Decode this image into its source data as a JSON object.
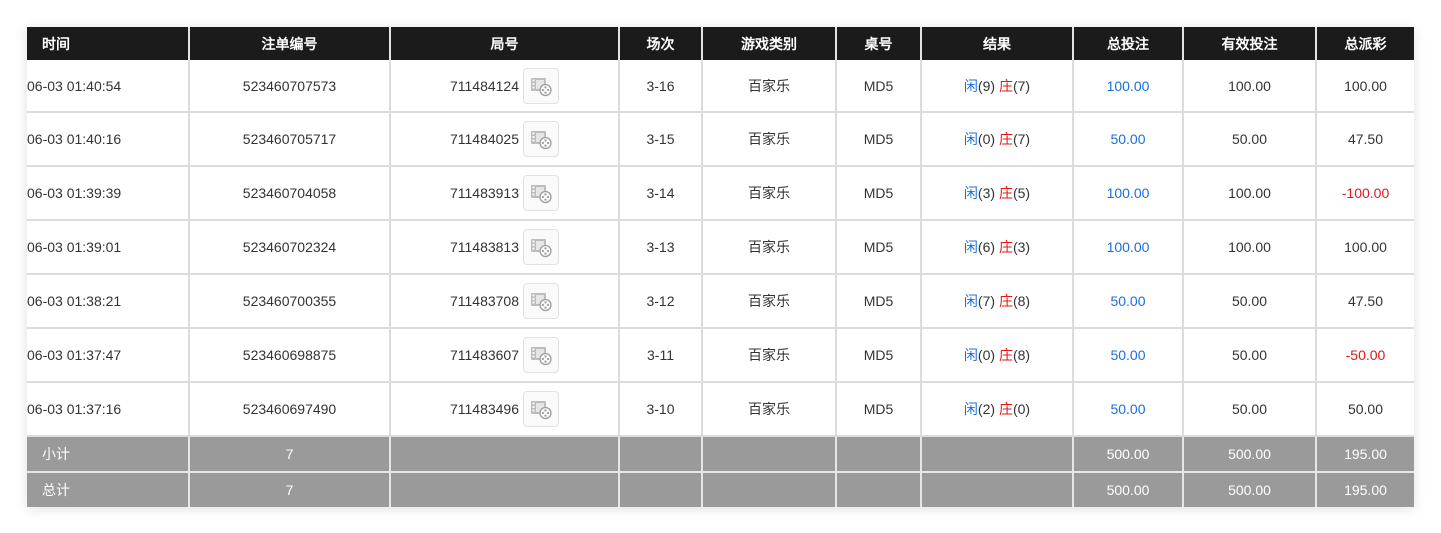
{
  "headers": [
    "时间",
    "注单编号",
    "局号",
    "场次",
    "游戏类别",
    "桌号",
    "结果",
    "总投注",
    "有效投注",
    "总派彩"
  ],
  "rows": [
    {
      "time": "06-03 01:40:54",
      "bet_no": "523460707573",
      "round": "711484124",
      "shoe": "3-16",
      "game": "百家乐",
      "table": "MD5",
      "player_label": "闲",
      "player_val": "(9)",
      "banker_label": "庄",
      "banker_val": "(7)",
      "total_bet": "100.00",
      "valid_bet": "100.00",
      "payout": "100.00",
      "payout_neg": false
    },
    {
      "time": "06-03 01:40:16",
      "bet_no": "523460705717",
      "round": "711484025",
      "shoe": "3-15",
      "game": "百家乐",
      "table": "MD5",
      "player_label": "闲",
      "player_val": "(0)",
      "banker_label": "庄",
      "banker_val": "(7)",
      "total_bet": "50.00",
      "valid_bet": "50.00",
      "payout": "47.50",
      "payout_neg": false
    },
    {
      "time": "06-03 01:39:39",
      "bet_no": "523460704058",
      "round": "711483913",
      "shoe": "3-14",
      "game": "百家乐",
      "table": "MD5",
      "player_label": "闲",
      "player_val": "(3)",
      "banker_label": "庄",
      "banker_val": "(5)",
      "total_bet": "100.00",
      "valid_bet": "100.00",
      "payout": "-100.00",
      "payout_neg": true
    },
    {
      "time": "06-03 01:39:01",
      "bet_no": "523460702324",
      "round": "711483813",
      "shoe": "3-13",
      "game": "百家乐",
      "table": "MD5",
      "player_label": "闲",
      "player_val": "(6)",
      "banker_label": "庄",
      "banker_val": "(3)",
      "total_bet": "100.00",
      "valid_bet": "100.00",
      "payout": "100.00",
      "payout_neg": false
    },
    {
      "time": "06-03 01:38:21",
      "bet_no": "523460700355",
      "round": "711483708",
      "shoe": "3-12",
      "game": "百家乐",
      "table": "MD5",
      "player_label": "闲",
      "player_val": "(7)",
      "banker_label": "庄",
      "banker_val": "(8)",
      "total_bet": "50.00",
      "valid_bet": "50.00",
      "payout": "47.50",
      "payout_neg": false
    },
    {
      "time": "06-03 01:37:47",
      "bet_no": "523460698875",
      "round": "711483607",
      "shoe": "3-11",
      "game": "百家乐",
      "table": "MD5",
      "player_label": "闲",
      "player_val": "(0)",
      "banker_label": "庄",
      "banker_val": "(8)",
      "total_bet": "50.00",
      "valid_bet": "50.00",
      "payout": "-50.00",
      "payout_neg": true
    },
    {
      "time": "06-03 01:37:16",
      "bet_no": "523460697490",
      "round": "711483496",
      "shoe": "3-10",
      "game": "百家乐",
      "table": "MD5",
      "player_label": "闲",
      "player_val": "(2)",
      "banker_label": "庄",
      "banker_val": "(0)",
      "total_bet": "50.00",
      "valid_bet": "50.00",
      "payout": "50.00",
      "payout_neg": false
    }
  ],
  "subtotal": {
    "label": "小计",
    "count": "7",
    "total_bet": "500.00",
    "valid_bet": "500.00",
    "payout": "195.00"
  },
  "grandtotal": {
    "label": "总计",
    "count": "7",
    "total_bet": "500.00",
    "valid_bet": "500.00",
    "payout": "195.00"
  },
  "icons": {
    "video_replay": "film-video-icon"
  },
  "colors": {
    "header_bg": "#1b1b1b",
    "summary_bg": "#9a9a9a",
    "blue": "#1a6fe0",
    "red": "#e01818"
  }
}
